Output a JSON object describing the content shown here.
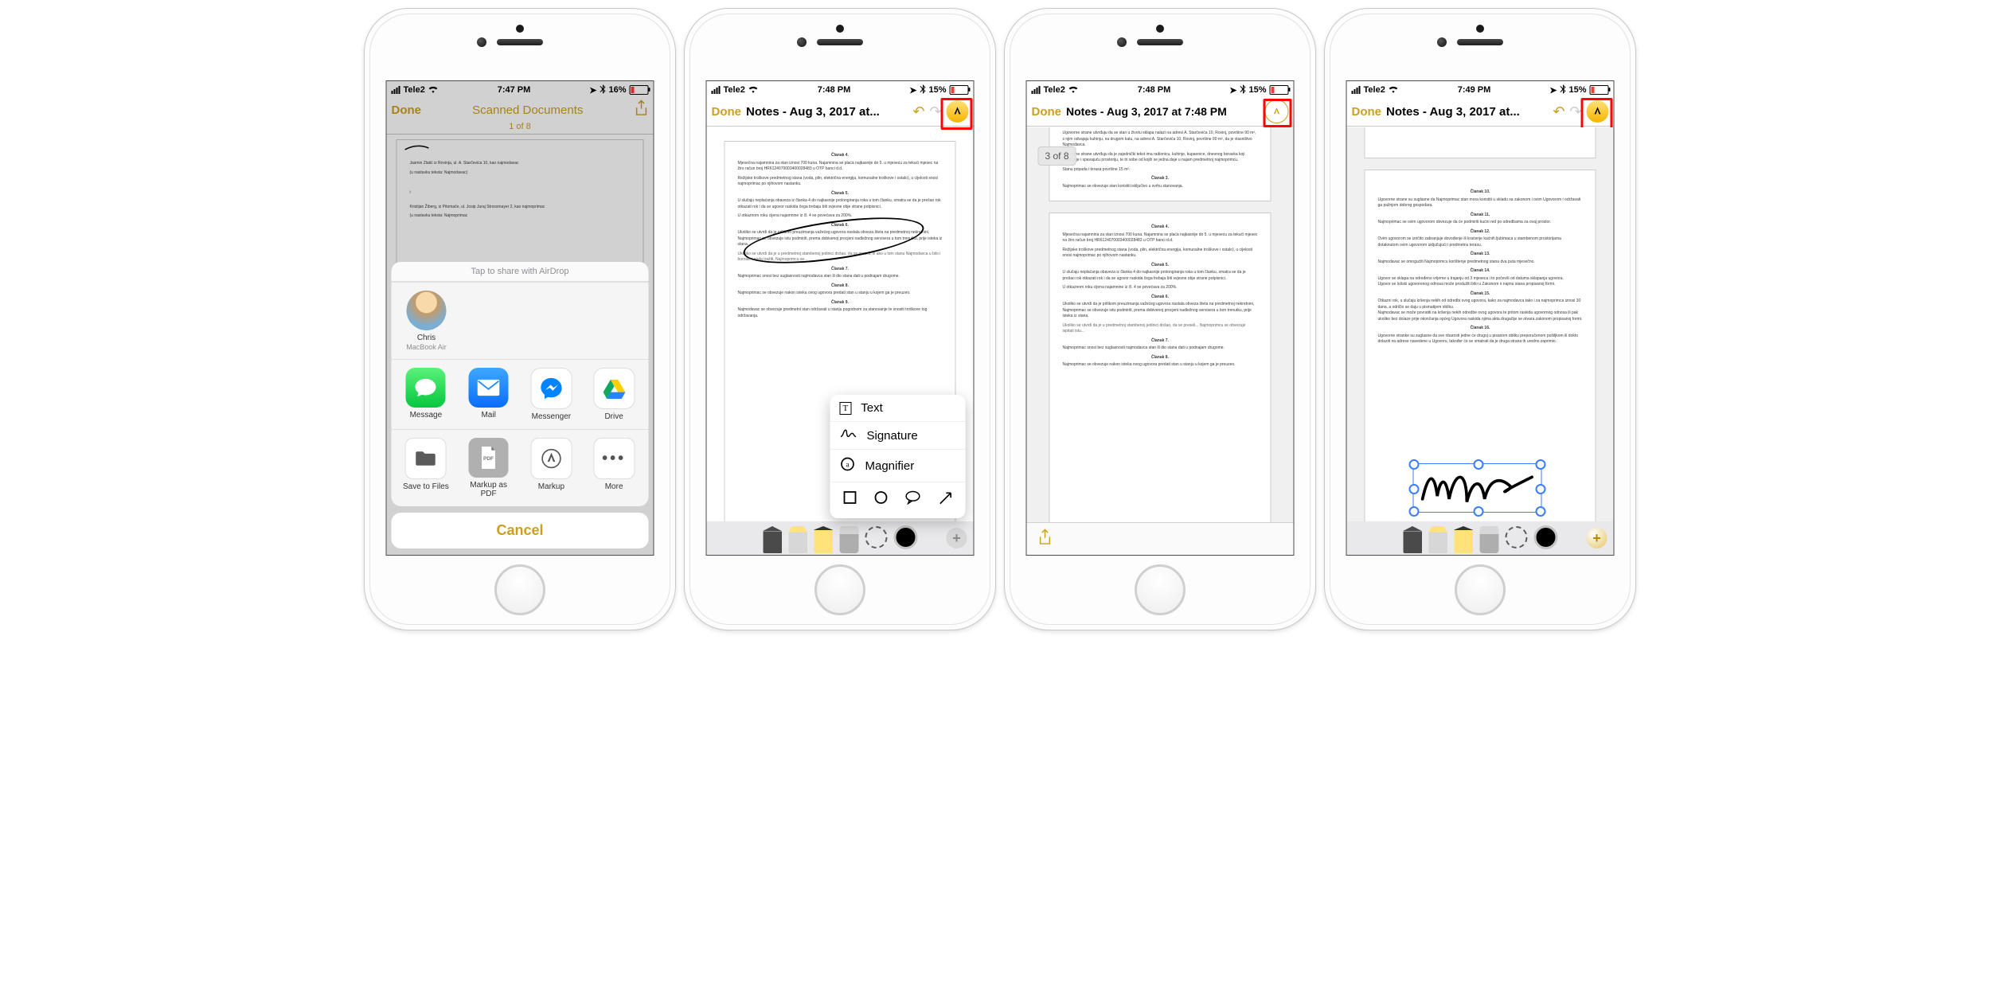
{
  "phones": {
    "p1": {
      "status": {
        "carrier": "Tele2",
        "time": "7:47 PM",
        "battery": "16%"
      },
      "nav": {
        "done": "Done",
        "title": "Scanned Documents",
        "counter": "1 of 8"
      },
      "doc": {
        "line1": "Jasmin Zlatić iz Rovinja, ul. A. Starčevića 10, kao najmodavac",
        "line2": "(u nastavku teksta: Najmodavac)",
        "line3": "Kristijan Žiberg, iz Pitomače, ul. Josip Juraj Strossmayer 2, kao najmoprimac",
        "line4": "(u nastavku teksta: Najmoprimac"
      },
      "sheet": {
        "airdrop": "Tap to share with AirDrop",
        "contact": {
          "name": "Chris",
          "device": "MacBook Air"
        },
        "apps": {
          "message": "Message",
          "mail": "Mail",
          "messenger": "Messenger",
          "drive": "Drive"
        },
        "actions": {
          "save": "Save to Files",
          "markuppdf": "Markup as\nPDF",
          "markup": "Markup",
          "more": "More"
        },
        "cancel": "Cancel"
      }
    },
    "p2": {
      "status": {
        "carrier": "Tele2",
        "time": "7:48 PM",
        "battery": "15%"
      },
      "nav": {
        "done": "Done",
        "title": "Notes - Aug 3, 2017 at..."
      },
      "popup": {
        "text": "Text",
        "signature": "Signature",
        "magnifier": "Magnifier"
      }
    },
    "p3": {
      "status": {
        "carrier": "Tele2",
        "time": "7:48 PM",
        "battery": "15%"
      },
      "nav": {
        "done": "Done",
        "title": "Notes - Aug 3, 2017 at 7:48 PM"
      },
      "badge": "3 of 8"
    },
    "p4": {
      "status": {
        "carrier": "Tele2",
        "time": "7:49 PM",
        "battery": "15%"
      },
      "nav": {
        "done": "Done",
        "title": "Notes - Aug 3, 2017 at..."
      }
    }
  },
  "articles": {
    "c3": "Članak 3.",
    "c4": "Članak 4.",
    "c5": "Članak 5.",
    "c6": "Članak 6.",
    "c7": "Članak 7.",
    "c8": "Članak 8.",
    "c9": "Članak 9.",
    "c10": "Članak 10.",
    "c11": "Članak 11.",
    "c12": "Članak 12.",
    "c13": "Članak 13.",
    "c14": "Članak 14.",
    "c15": "Članak 15.",
    "c16": "Članak 16.",
    "t3": "Najmoprimac se obvezuje stan koristiti isključivo u svrhu stanovanja.",
    "t4a": "Mjesečna najamnina za stan iznosi 700 kuna. Najamnina se plaća najkasnije do 5. u mjesecu za tekući mjesec na žiro račun broj HR6124070003400028483 u OTP banci d.d.",
    "t4b": "Režijske troškove predmetnog stana (voda, plin, električna energija, komunalne troškove i ostalo), u cijelosti snosi najmoprimac po njihovom nastanku.",
    "t5a": "U slučaju neplaćanja obaveza iz članka 4 do najkasnije prolongiranja roka u tom članku, smatra se da je prešao rok otkazati rok i da se ugovor raskida čega trebaju biti svjesne obje strane potpisnici.",
    "t5b": "U otkaznom roku cijena najamnine iz čl. 4 se povećava za 200%.",
    "t6": "Ukoliko se utvrdi da je prilikom preuzimanja važećeg ugovora nastala obveza šteta na predmetnoj nekretnini, Najmoprimac se obvezuje istu podmiriti, prema dobivenoj procjeni nadležnog servisera u tom trenutku, prije isteka iz stana.",
    "t7": "Najmoprimac snosi bez suglasnosti najmodavca stan ili dio stana dati u podnajam drugome.",
    "t8": "Najmoprimac se obvezuje nakon isteka ovog ugovora predati stan u stanju u kojem ga je preuzeo.",
    "t9": "Najmodavac se obvezuje predmetni stan održavati u stanju pogodnom za stanovanje te snositi troškove tog održavanja.",
    "t10": "Ugovorne strane su suglasne da Najmoprimac stan mora koristiti u skladu sa zakonom i ovim Ugovorom i održavati ga pažnjom dobrog gospodara.",
    "t11": "Najmoprimac se ovim ugovorom obvezuje da će podmiriti kućni red po odredbama za ovaj prostor.",
    "t12": "Ovim ugovorom se izričito zabranjuje dovođenje ili kraćenje kućnih ljubimaca u stambenom prostorijama dotaknutom ovim ugovorom uključujući i predmetnu terasu.",
    "t13": "Najmodavac se omogućiti Najmoprimcu korištenje predmetnog stana dva puta mjesečno.",
    "t14": "Ugovor se sklapa na određeno vrijeme u trajanju od 3 mjeseca i to počevši od datuma sklapanja ugovora.\nUgovor se lošski ugovorenog odnosa može produžiti bilo u Zakonom o najmu stana propisanoj formi.",
    "t15": "Otkazni rok, u slučaju kršenja nekih od odredbi ovog ugovora, kako za najmodavca tako i za najmoprimca iznosi 30 dana, a odričlo se daju u pismatijem obliku.\nNajmodavac se može povratiti na kršenja nekih odredbe ovog ugovora te pritom raskida ugovornog odnosa ili pak ukoliko bez dolaze prije okončanja općeg Ugovora raskida njima akta drugačije se otvara zakonom propisanoj formi.",
    "t16": "Ugovorne stranke su suglasne da sve nbarosti jedne će drugoj u pisanom obliku preporučenom pošiljkom ili dokto dolaziti na adrese navedene u Ugovoru, također će se smatrati da je druga strana ih uredno zaprimio.",
    "intro1": "Ugovorne strane utvrđuju da se stan u životu sklapa nalazi na adresi A. Starčevića 10, Rovinj, površine 90 m², s njim odvajaju kuhinju, na drugom katu, na adresi A. Starčevića 10, Rovinj, površine 90 m², da je vlasništvo Najmodavca.",
    "intro2": "Ugovorne strane utvrđuju da je zajednički tekst ima radionicu, kuhinje, kupaonice, dnevnog boravka koji ujedinjuje i spavajuću prostoriju, te tri sobe od kojih se jedna daje u najam predmetnoj najmoprimcu.",
    "intro3": "Stanu pripada i terasa površine 15 m²."
  }
}
